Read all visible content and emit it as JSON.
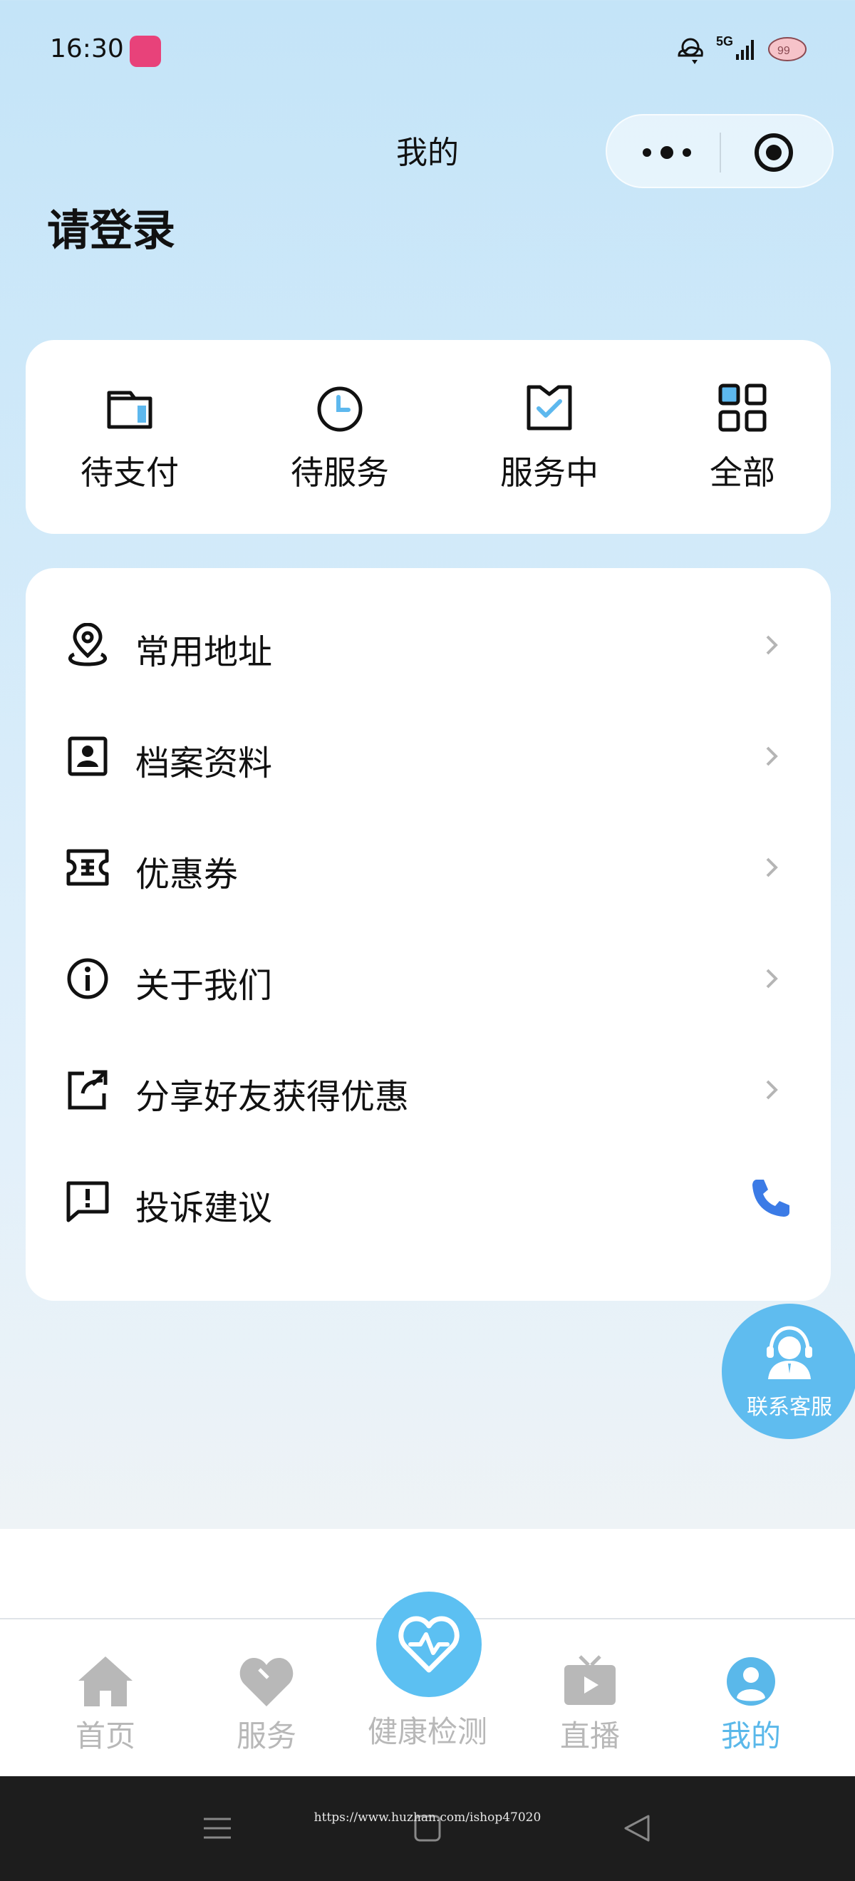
{
  "status_bar": {
    "time": "16:30",
    "network": "5G",
    "badge": "99",
    "icons": [
      "app-icon",
      "weather-icon",
      "signal-icon",
      "battery-icon"
    ]
  },
  "header": {
    "title": "我的",
    "login_prompt": "请登录",
    "capsule_icons": [
      "more-icon",
      "close-icon"
    ]
  },
  "orders": [
    {
      "label": "待支付",
      "icon": "wallet-icon"
    },
    {
      "label": "待服务",
      "icon": "clock-icon"
    },
    {
      "label": "服务中",
      "icon": "clipboard-check-icon"
    },
    {
      "label": "全部",
      "icon": "grid-icon"
    }
  ],
  "menu": [
    {
      "label": "常用地址",
      "icon": "location-icon",
      "trailing": "chevron"
    },
    {
      "label": "档案资料",
      "icon": "profile-card-icon",
      "trailing": "chevron"
    },
    {
      "label": "优惠券",
      "icon": "ticket-icon",
      "trailing": "chevron"
    },
    {
      "label": "关于我们",
      "icon": "info-icon",
      "trailing": "chevron"
    },
    {
      "label": "分享好友获得优惠",
      "icon": "share-icon",
      "trailing": "chevron"
    },
    {
      "label": "投诉建议",
      "icon": "feedback-icon",
      "trailing": "phone"
    }
  ],
  "service_button": {
    "label": "联系客服",
    "icon": "customer-service-icon"
  },
  "tabbar": [
    {
      "label": "首页",
      "icon": "home-icon",
      "active": false
    },
    {
      "label": "服务",
      "icon": "heart-icon",
      "active": false
    },
    {
      "label": "健康检测",
      "icon": "heartbeat-icon",
      "active": false
    },
    {
      "label": "直播",
      "icon": "tv-icon",
      "active": false
    },
    {
      "label": "我的",
      "icon": "user-icon",
      "active": true
    }
  ],
  "watermark": "https://www.huzhan.com/ishop47020",
  "colors": {
    "accent": "#5ab8ea",
    "tab_inactive": "#b8b8b8",
    "icon_accent": "#5db8ee",
    "phone": "#3b7be6",
    "background_top": "#c4e4f8"
  }
}
